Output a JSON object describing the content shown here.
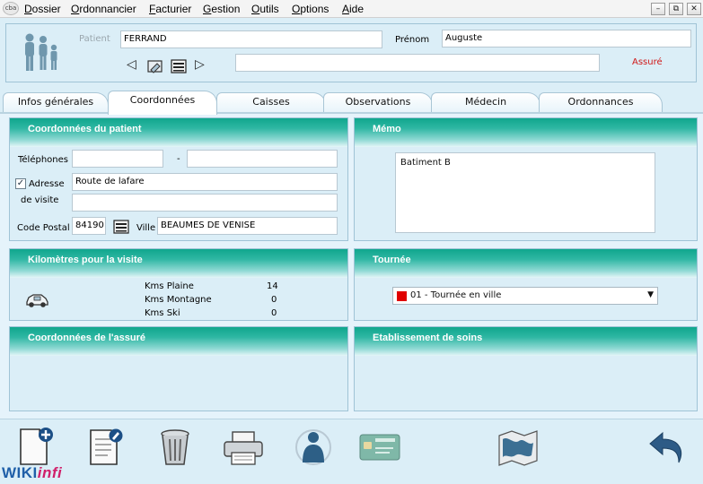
{
  "app": {
    "logo_text": "cba"
  },
  "menu": {
    "items": [
      "Dossier",
      "Ordonnancier",
      "Facturier",
      "Gestion",
      "Outils",
      "Options",
      "Aide"
    ]
  },
  "window_controls": {
    "minimize": "–",
    "restore": "⧉",
    "close": "✕"
  },
  "header": {
    "patient_label": "Patient",
    "patient_value": "FERRAND",
    "prenom_label": "Prénom",
    "prenom_value": "Auguste",
    "extra_value": "",
    "status": "Assuré",
    "nav_prev": "◁",
    "nav_next": "▷"
  },
  "tabs": [
    "Infos générales",
    "Coordonnées",
    "Caisses",
    "Observations",
    "Médecin",
    "Ordonnances"
  ],
  "active_tab": "Coordonnées",
  "coords": {
    "title": "Coordonnées du patient",
    "telephones_label": "Téléphones",
    "phone1": "",
    "phone_sep": "-",
    "phone2": "",
    "adresse_label": "Adresse",
    "de_visite_label": "de visite",
    "address_checked": true,
    "address1": "Route de lafare",
    "address2": "",
    "code_postal_label": "Code Postal",
    "code_postal_value": "84190",
    "ville_label": "Ville",
    "ville_value": "BEAUMES DE VENISE"
  },
  "memo": {
    "title": "Mémo",
    "text": "Batiment B"
  },
  "kms": {
    "title": "Kilomètres pour la visite",
    "rows": [
      {
        "label": "Kms Plaine",
        "value": "14"
      },
      {
        "label": "Kms Montagne",
        "value": "0"
      },
      {
        "label": "Kms Ski",
        "value": "0"
      }
    ]
  },
  "tournee": {
    "title": "Tournée",
    "selected": "01 - Tournée en ville",
    "color": "#e00000"
  },
  "assure": {
    "title": "Coordonnées de l'assuré"
  },
  "etablissement": {
    "title": "Etablissement de soins"
  },
  "brand": {
    "part1": "WIKI",
    "part2": "infi"
  },
  "colors": {
    "accent_teal": "#10a68d",
    "status_red": "#d01818",
    "brand_blue": "#1f5fa8",
    "brand_pink": "#d0206b"
  }
}
